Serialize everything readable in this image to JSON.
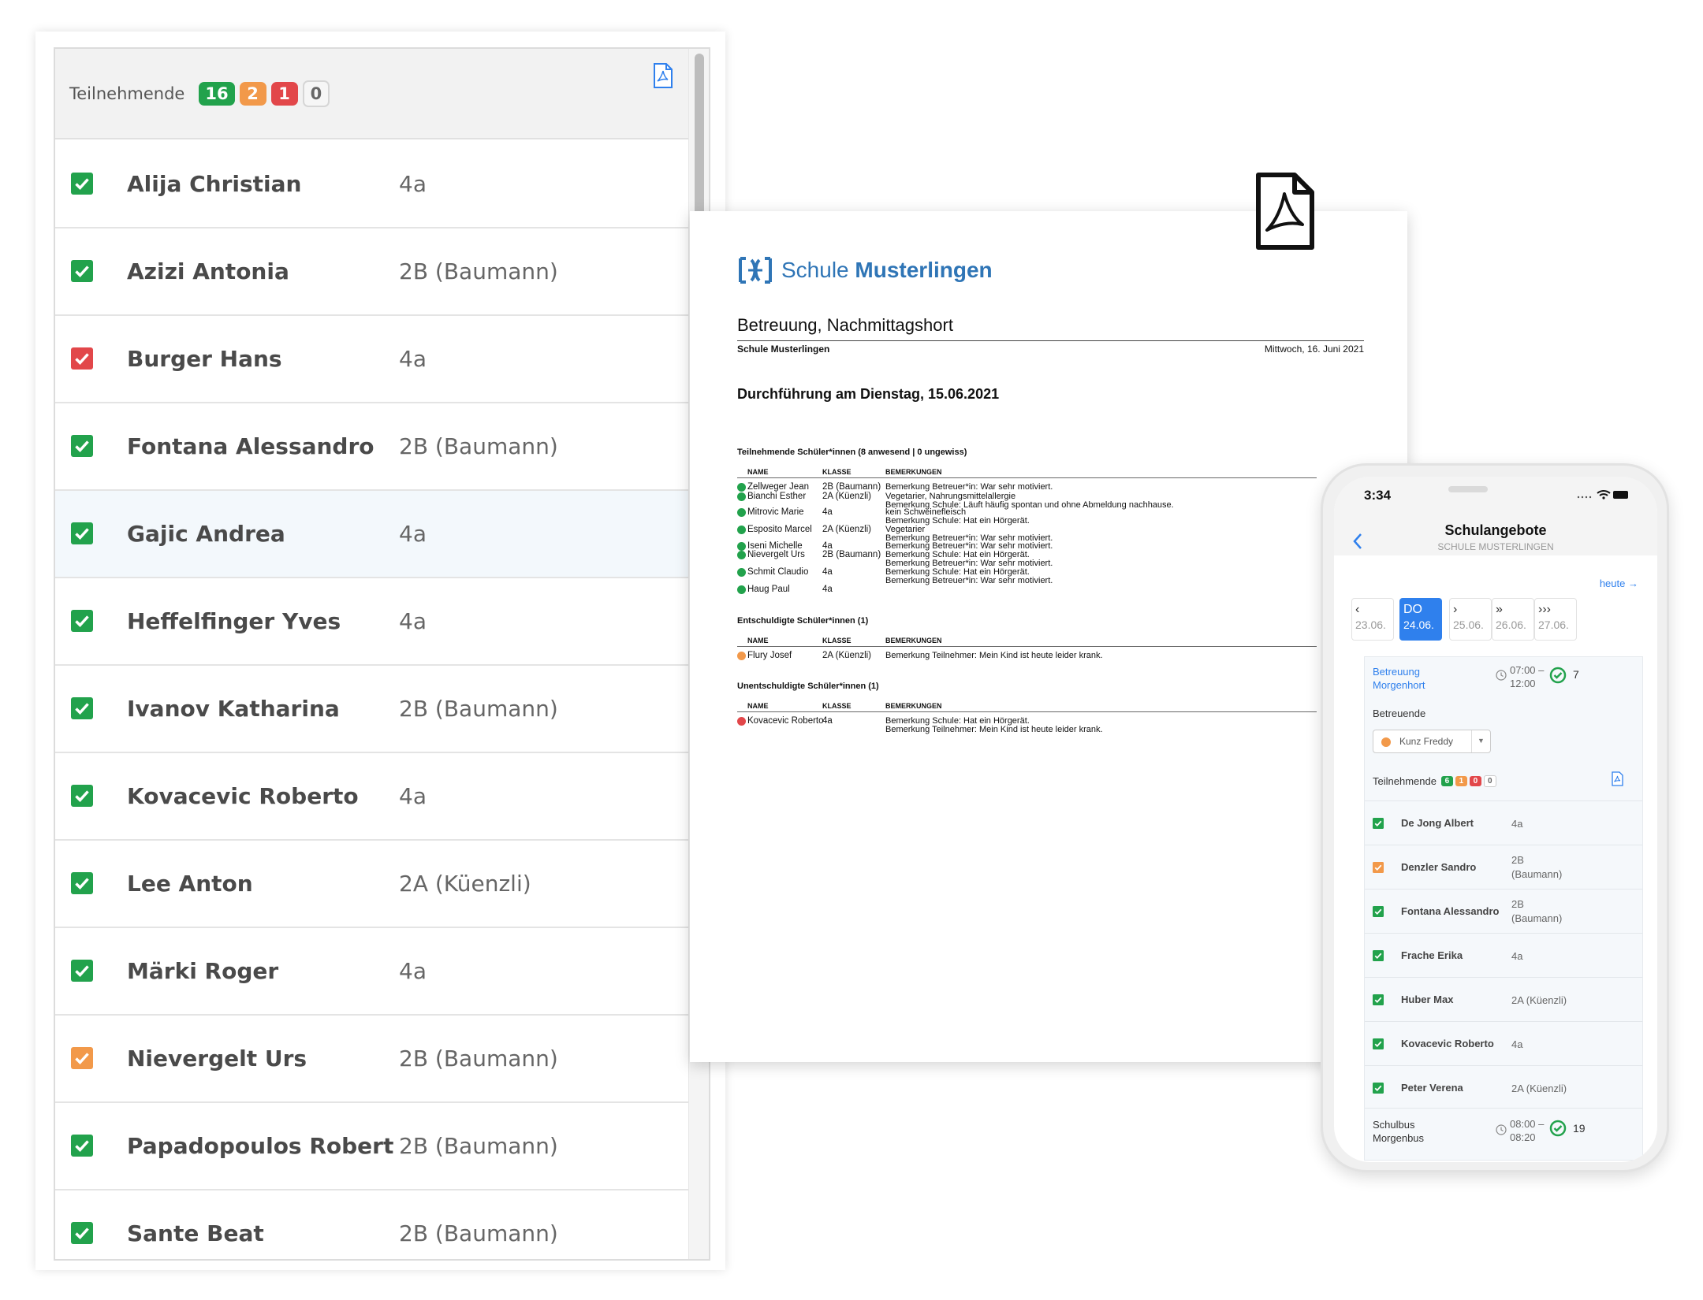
{
  "panel": {
    "title": "Teilnehmende",
    "badges": {
      "present": "16",
      "excused": "2",
      "absent": "1",
      "unknown": "0"
    },
    "rows": [
      {
        "name": "Alija Christian",
        "class": "4a",
        "status": "present"
      },
      {
        "name": "Azizi Antonia",
        "class": "2B (Baumann)",
        "status": "present"
      },
      {
        "name": "Burger Hans",
        "class": "4a",
        "status": "absent"
      },
      {
        "name": "Fontana Alessandro",
        "class": "2B (Baumann)",
        "status": "present"
      },
      {
        "name": "Gajic Andrea",
        "class": "4a",
        "status": "present"
      },
      {
        "name": "Heffelfinger Yves",
        "class": "4a",
        "status": "present"
      },
      {
        "name": "Ivanov Katharina",
        "class": "2B (Baumann)",
        "status": "present"
      },
      {
        "name": "Kovacevic Roberto",
        "class": "4a",
        "status": "present"
      },
      {
        "name": "Lee Anton",
        "class": "2A (Küenzli)",
        "status": "present"
      },
      {
        "name": "Märki Roger",
        "class": "4a",
        "status": "present"
      },
      {
        "name": "Nievergelt Urs",
        "class": "2B (Baumann)",
        "status": "excused"
      },
      {
        "name": "Papadopoulos Robert",
        "class": "2B (Baumann)",
        "status": "present"
      },
      {
        "name": "Sante Beat",
        "class": "2B (Baumann)",
        "status": "present"
      }
    ]
  },
  "doc": {
    "logo": {
      "word1": "Schule",
      "word2": "Musterlingen"
    },
    "title": "Betreuung, Nachmittagshort",
    "school": "Schule Musterlingen",
    "date": "Mittwoch, 16. Juni 2021",
    "heading": "Durchführung am Dienstag, 15.06.2021",
    "headers": {
      "name": "NAME",
      "class": "KLASSE",
      "remarks": "BEMERKUNGEN"
    },
    "section1": {
      "title": "Teilnehmende Schüler*innen (8 anwesend | 0 ungewiss)",
      "rows": [
        {
          "name": "Zellweger Jean",
          "class": "2B (Baumann)",
          "remarks": [
            "Bemerkung Betreuer*in: War sehr motiviert."
          ]
        },
        {
          "name": "Bianchi Esther",
          "class": "2A (Küenzli)",
          "remarks": [
            "Vegetarier, Nahrungsmittelallergie",
            "Bemerkung Schule: Läuft häufig spontan und ohne Abmeldung nachhause."
          ]
        },
        {
          "name": "Mitrovic Marie",
          "class": "4a",
          "remarks": [
            "kein Schweinefleisch",
            "Bemerkung Schule: Hat ein Hörgerät."
          ]
        },
        {
          "name": "Esposito Marcel",
          "class": "2A (Küenzli)",
          "remarks": [
            "Vegetarier",
            "Bemerkung Betreuer*in: War sehr motiviert."
          ]
        },
        {
          "name": "Iseni Michelle",
          "class": "4a",
          "remarks": [
            "Bemerkung Betreuer*in: War sehr motiviert."
          ]
        },
        {
          "name": "Nievergelt Urs",
          "class": "2B (Baumann)",
          "remarks": [
            "Bemerkung Schule: Hat ein Hörgerät.",
            "Bemerkung Betreuer*in: War sehr motiviert."
          ]
        },
        {
          "name": "Schmit Claudio",
          "class": "4a",
          "remarks": [
            "Bemerkung Schule: Hat ein Hörgerät.",
            "Bemerkung Betreuer*in: War sehr motiviert."
          ]
        },
        {
          "name": "Haug Paul",
          "class": "4a",
          "remarks": []
        }
      ]
    },
    "section2": {
      "title": "Entschuldigte Schüler*innen (1)",
      "rows": [
        {
          "name": "Flury Josef",
          "class": "2A (Küenzli)",
          "remarks": [
            "Bemerkung Teilnehmer: Mein Kind ist heute leider krank."
          ]
        }
      ]
    },
    "section3": {
      "title": "Unentschuldigte Schüler*innen (1)",
      "rows": [
        {
          "name": "Kovacevic Roberto",
          "class": "4a",
          "remarks": [
            "Bemerkung Schule: Hat ein Hörgerät.",
            "Bemerkung Teilnehmer: Mein Kind ist heute leider krank."
          ]
        }
      ]
    }
  },
  "phone": {
    "time": "3:34",
    "title": "Schulangebote",
    "subtitle": "SCHULE MUSTERLINGEN",
    "today_link": "heute",
    "days": [
      {
        "top": "‹",
        "date": "23.06."
      },
      {
        "top": "DO",
        "date": "24.06.",
        "active": true
      },
      {
        "top": "›",
        "date": "25.06."
      },
      {
        "top": "»",
        "date": "26.06."
      },
      {
        "top": "›››",
        "date": "27.06."
      }
    ],
    "offer": {
      "name_line1": "Betreuung",
      "name_line2": "Morgenhort",
      "time_line1": "07:00 –",
      "time_line2": "12:00",
      "count": "7"
    },
    "carer_label": "Betreuende",
    "carer_select": "Kunz Freddy",
    "participants_label": "Teilnehmende",
    "badges": {
      "present": "6",
      "excused": "1",
      "absent": "0",
      "unknown": "0"
    },
    "rows": [
      {
        "name": "De Jong Albert",
        "class1": "4a",
        "class2": "",
        "status": "present"
      },
      {
        "name": "Denzler Sandro",
        "class1": "2B",
        "class2": "(Baumann)",
        "status": "excused"
      },
      {
        "name": "Fontana Alessandro",
        "class1": "2B",
        "class2": "(Baumann)",
        "status": "present"
      },
      {
        "name": "Frache Erika",
        "class1": "4a",
        "class2": "",
        "status": "present"
      },
      {
        "name": "Huber Max",
        "class1": "2A (Küenzli)",
        "class2": "",
        "status": "present"
      },
      {
        "name": "Kovacevic Roberto",
        "class1": "4a",
        "class2": "",
        "status": "present"
      },
      {
        "name": "Peter Verena",
        "class1": "2A (Küenzli)",
        "class2": "",
        "status": "present"
      }
    ],
    "bus": {
      "name_line1": "Schulbus",
      "name_line2": "Morgenbus",
      "time_line1": "08:00 –",
      "time_line2": "08:20",
      "count": "19"
    }
  },
  "colors": {
    "present": "#22a24c",
    "excused": "#f2994a",
    "absent": "#e2474a",
    "accent": "#2f80ed"
  }
}
